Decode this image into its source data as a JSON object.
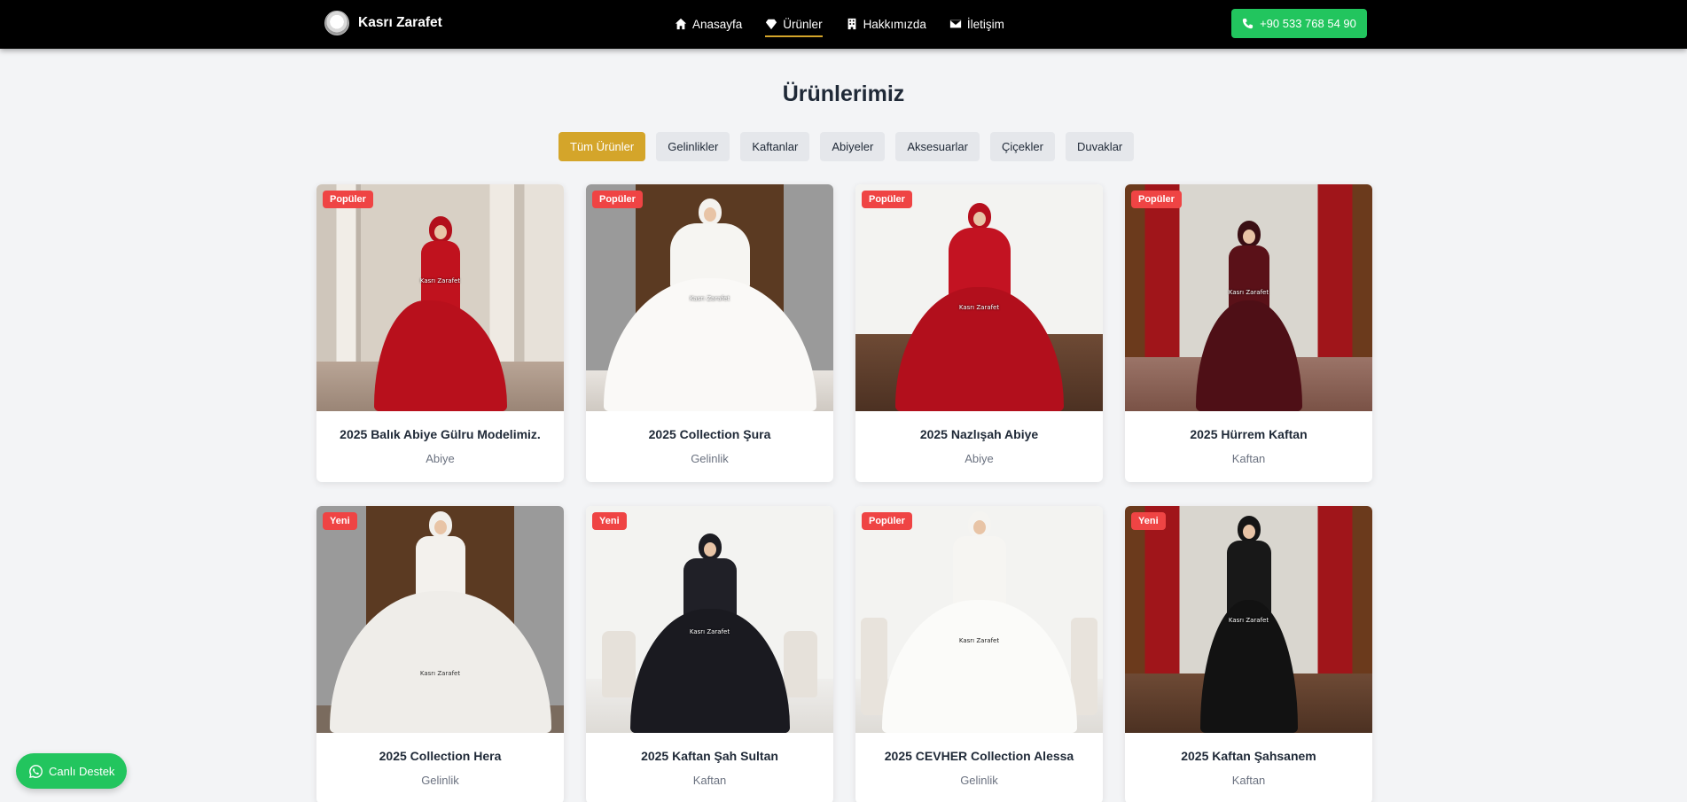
{
  "brand": {
    "name": "Kasrı Zarafet"
  },
  "nav": [
    {
      "label": "Anasayfa",
      "icon": "home-icon"
    },
    {
      "label": "Ürünler",
      "icon": "diamond-icon",
      "active": true
    },
    {
      "label": "Hakkımızda",
      "icon": "building-icon"
    },
    {
      "label": "İletişim",
      "icon": "envelope-icon"
    }
  ],
  "phone": {
    "label": "+90 533 768 54 90",
    "icon": "phone-icon"
  },
  "page": {
    "title": "Ürünlerimiz"
  },
  "filters": [
    {
      "label": "Tüm Ürünler",
      "active": true
    },
    {
      "label": "Gelinlikler"
    },
    {
      "label": "Kaftanlar"
    },
    {
      "label": "Abiyeler"
    },
    {
      "label": "Aksesuarlar"
    },
    {
      "label": "Çiçekler"
    },
    {
      "label": "Duvaklar"
    }
  ],
  "products": [
    {
      "badge": "Popüler",
      "title": "2025 Balık Abiye Gülru Modelimiz.",
      "category": "Abiye",
      "watermark": "Kasrı Zarafet"
    },
    {
      "badge": "Popüler",
      "title": "2025 Collection Şura",
      "category": "Gelinlik",
      "watermark": "Kasrı Zarafet"
    },
    {
      "badge": "Popüler",
      "title": "2025 Nazlışah Abiye",
      "category": "Abiye",
      "watermark": "Kasrı Zarafet"
    },
    {
      "badge": "Popüler",
      "title": "2025 Hürrem Kaftan",
      "category": "Kaftan",
      "watermark": "Kasrı Zarafet"
    },
    {
      "badge": "Yeni",
      "title": "2025 Collection Hera",
      "category": "Gelinlik",
      "watermark": "Kasrı Zarafet"
    },
    {
      "badge": "Yeni",
      "title": "2025 Kaftan Şah Sultan",
      "category": "Kaftan",
      "watermark": "Kasrı Zarafet"
    },
    {
      "badge": "Popüler",
      "title": "2025 CEVHER Collection Alessa",
      "category": "Gelinlik",
      "watermark": "Kasrı Zarafet"
    },
    {
      "badge": "Yeni",
      "title": "2025 Kaftan Şahsanem",
      "category": "Kaftan",
      "watermark": "Kasrı Zarafet"
    }
  ],
  "support": {
    "label": "Canlı Destek",
    "icon": "whatsapp-icon"
  },
  "colors": {
    "accent": "#d4a52a",
    "badge": "#ef4444",
    "whatsapp": "#22c55e",
    "header": "#000000"
  }
}
